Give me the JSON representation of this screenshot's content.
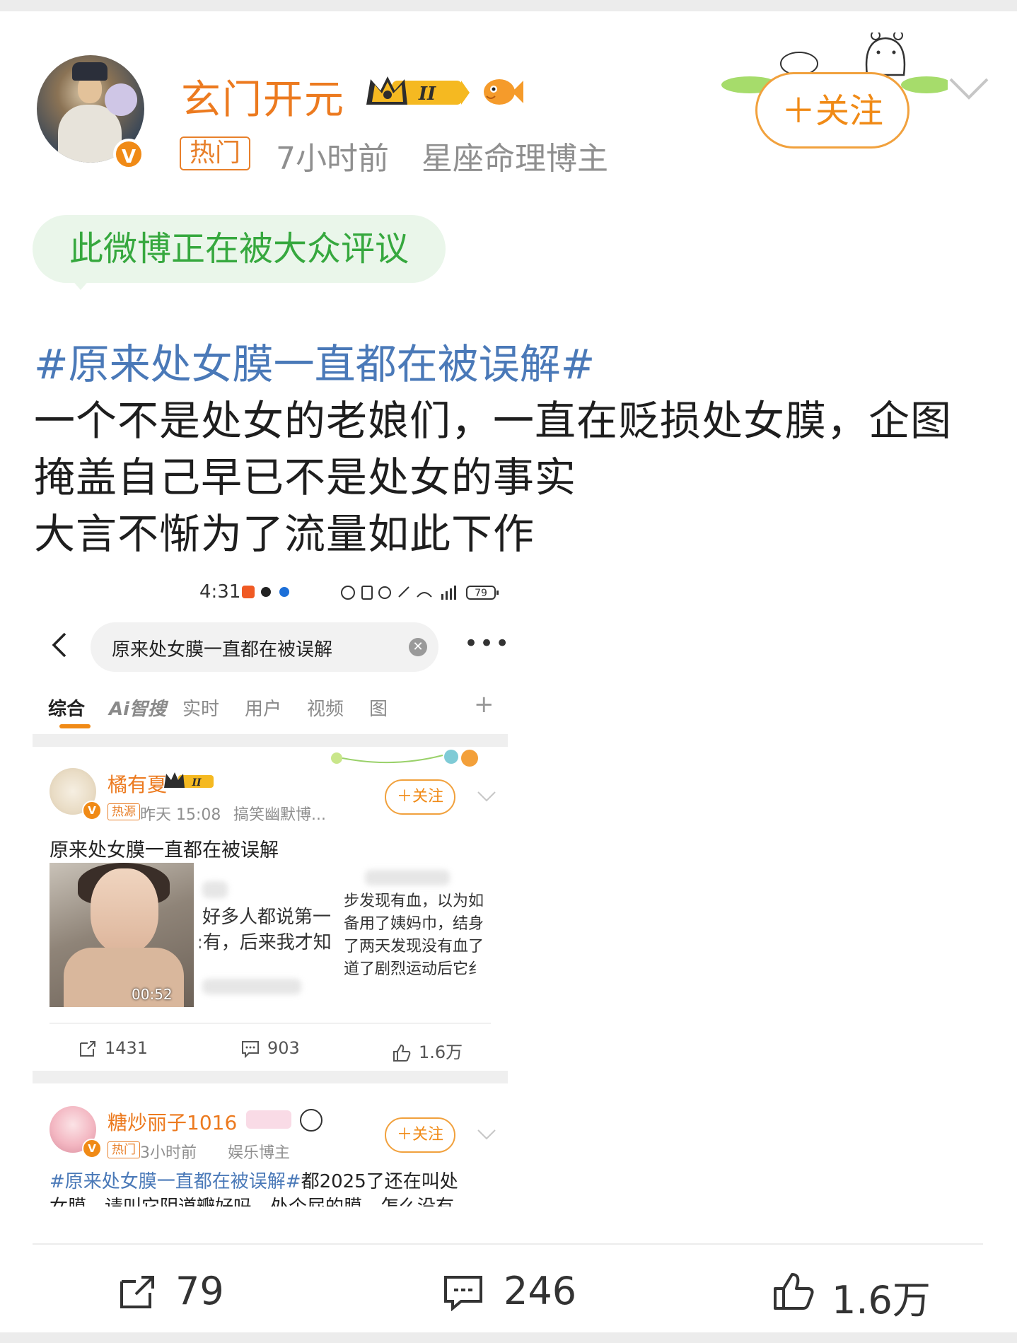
{
  "post": {
    "username": "玄门开元",
    "level_badge": "II",
    "hot_tag": "热门",
    "time": "7小时前",
    "role": "星座命理博主",
    "follow_label": "＋关注",
    "bubble_text": "此微博正在被大众评议",
    "hashtag": "#原来处女膜一直都在被误解#",
    "lines": [
      "一个不是处女的老娘们，一直在贬损处女膜，企图",
      "掩盖自己早已不是处女的事实",
      "大言不惭为了流量如此下作"
    ]
  },
  "screenshot": {
    "status_time": "4:31",
    "battery": "79",
    "search_text": "原来处女膜一直都在被误解",
    "tabs": [
      "综合",
      "Ai智搜",
      "实时",
      "用户",
      "视频",
      "图"
    ],
    "item1": {
      "name": "橘有夏",
      "level_badge": "II",
      "tag": "热源",
      "time": "昨天 15:08",
      "role": "搞笑幽默博...",
      "follow": "＋关注",
      "title": "原来处女膜一直都在被误解",
      "video_duration": "00:52",
      "video_text": [
        "步发现有血，以为如",
        "好多人都说第一",
        "备用了姨妈巾，结身",
        ":有，后来我才知",
        "了两天发现没有血了",
        "道了剧烈运动后它纟"
      ],
      "reposts": "1431",
      "comments": "903",
      "likes": "1.6万"
    },
    "item2": {
      "name": "糖炒丽子1016",
      "tag": "热门",
      "time": "3小时前",
      "role": "娱乐博主",
      "follow": "＋关注",
      "hashtag": "#原来处女膜一直都在被误解#",
      "body_line1": "都2025了还在叫处",
      "body_line2": "女膜，请叫它阴道瓣好吗，处个屁的膜，怎么没有"
    }
  },
  "footer": {
    "reposts": "79",
    "comments": "246",
    "likes": "1.6万"
  },
  "colors": {
    "brand_orange": "#f08a16",
    "hashtag_blue": "#4a79b8",
    "bubble_green": "#36a83e",
    "bubble_bg": "#eaf6ea"
  },
  "icons": [
    "verified-v-icon",
    "crown-level-icon",
    "fish-icon",
    "chevron-down-icon",
    "back-arrow-icon",
    "clear-icon",
    "more-icon",
    "plus-icon",
    "repost-icon",
    "comment-icon",
    "like-icon"
  ]
}
